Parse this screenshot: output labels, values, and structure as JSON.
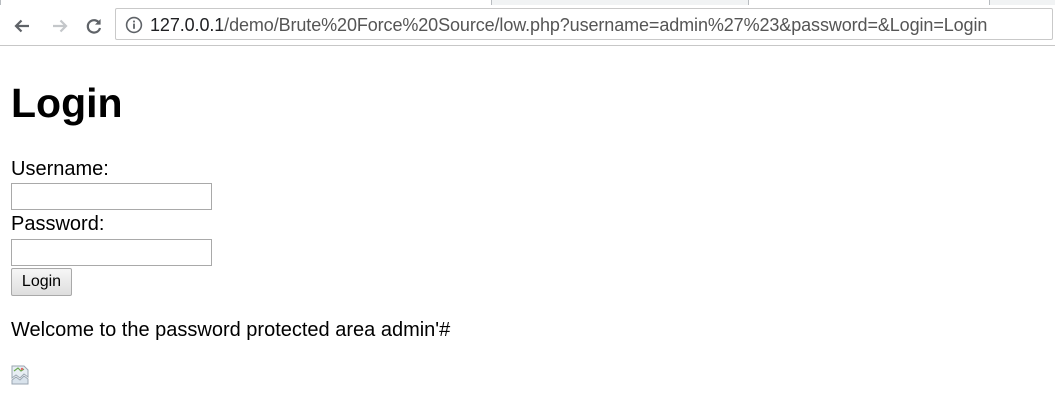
{
  "browser": {
    "url_host": "127.0.0.1",
    "url_path": "/demo/Brute%20Force%20Source/low.php?username=admin%27%23&password=&Login=Login",
    "back_icon": "back-arrow-icon",
    "forward_icon": "forward-arrow-icon",
    "reload_icon": "reload-icon",
    "info_icon": "info-icon"
  },
  "page": {
    "title": "Login",
    "username_label": "Username:",
    "username_value": "",
    "password_label": "Password:",
    "password_value": "",
    "login_button": "Login",
    "welcome_message": "Welcome to the password protected area admin'#",
    "image_icon": "broken-image-icon"
  }
}
